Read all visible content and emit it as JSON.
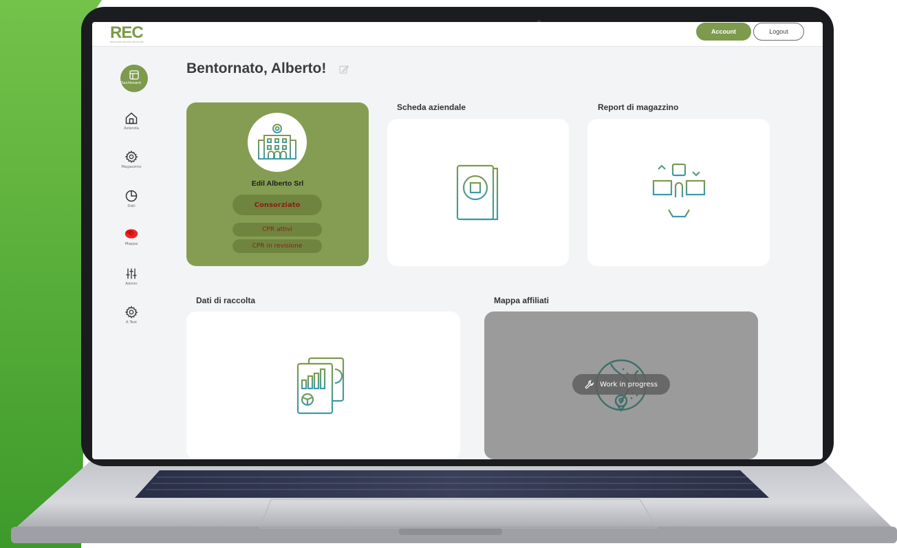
{
  "header": {
    "logo_text": "REC",
    "logo_subtitle": "RECYCLING EDILIZIA CIRCOLARE",
    "account_label": "Account",
    "logout_label": "Logout"
  },
  "sidebar": {
    "items": [
      {
        "label": "Dashboard",
        "icon": "dashboard-icon"
      },
      {
        "label": "Azienda",
        "icon": "home-icon"
      },
      {
        "label": "Magazzino",
        "icon": "gear-icon"
      },
      {
        "label": "Dati",
        "icon": "pie-chart-icon"
      },
      {
        "label": "Mappa",
        "icon": "map-icon"
      },
      {
        "label": "Admin",
        "icon": "sliders-icon"
      },
      {
        "label": "A Test",
        "icon": "gear-icon"
      }
    ]
  },
  "main": {
    "title": "Bentornato, Alberto!",
    "company": {
      "name": "Edil Alberto Srl",
      "status": "Consorziato",
      "link_1": "CPR attivi",
      "link_2": "CPR in revisione"
    },
    "sections": {
      "scheda": "Scheda aziendale",
      "report": "Report di magazzino",
      "dati": "Dati di raccolta",
      "mappa": "Mappa affiliati"
    },
    "wip_label": "Work in progress"
  },
  "colors": {
    "brand_green": "#7d9a4d",
    "card_green": "#859d52",
    "status_red": "#8a1f15",
    "icon_teal": "#3a9aa8"
  }
}
